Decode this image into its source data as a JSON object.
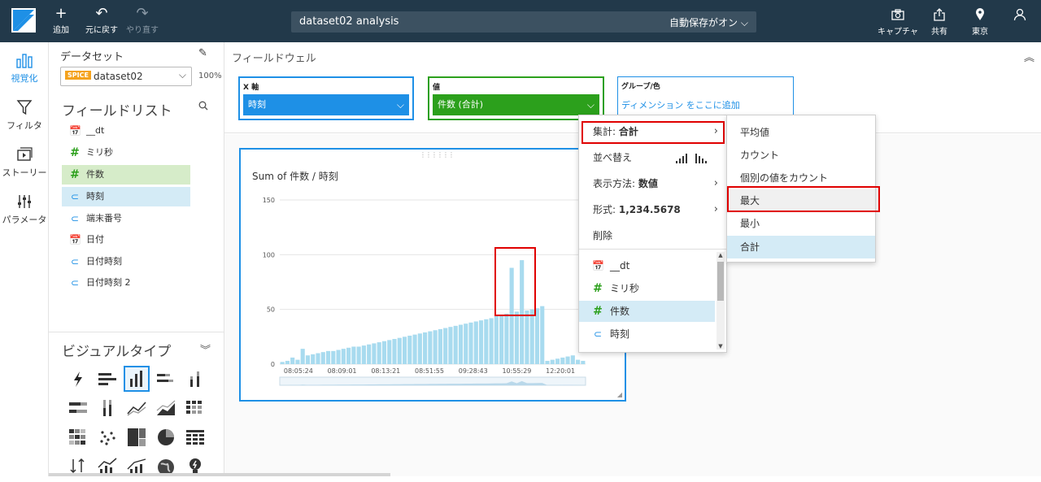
{
  "toolbar": {
    "add_label": "追加",
    "undo_label": "元に戻す",
    "redo_label": "やり直す",
    "analysis_name": "dataset02 analysis",
    "autosave_label": "自動保存がオン",
    "capture_label": "キャプチャ",
    "share_label": "共有",
    "region_label": "東京"
  },
  "nav": {
    "visualize": "視覚化",
    "filter": "フィルタ",
    "story": "ストーリー",
    "parameter": "パラメータ"
  },
  "fieldpanel": {
    "dataset_label": "データセット",
    "spice_badge": "SPICE",
    "dataset_name": "dataset02",
    "percent": "100%",
    "field_list_title": "フィールドリスト",
    "fields": [
      "__dt",
      "ミリ秒",
      "件数",
      "時刻",
      "端末番号",
      "日付",
      "日付時刻",
      "日付時刻 2"
    ],
    "visual_types_title": "ビジュアルタイプ"
  },
  "wells": {
    "title": "フィールドウェル",
    "x_axis_label": "X 軸",
    "x_axis_field": "時刻",
    "value_label": "値",
    "value_field": "件数 (合計)",
    "group_label": "グループ/色",
    "group_placeholder": "ディメンション をここに追加"
  },
  "visual": {
    "title": "Sum of 件数 / 時刻"
  },
  "chart_data": {
    "type": "bar",
    "title": "Sum of 件数 / 時刻",
    "xlabel": "",
    "ylabel": "",
    "ylim": [
      0,
      150
    ],
    "y_ticks": [
      "150",
      "100",
      "50",
      "0"
    ],
    "x_ticks": [
      "08:05:24",
      "08:09:01",
      "08:13:21",
      "08:51:55",
      "09:28:43",
      "10:55:29",
      "12:20:01"
    ],
    "values": [
      2,
      3,
      6,
      4,
      14,
      8,
      9,
      10,
      11,
      12,
      12,
      13,
      14,
      15,
      16,
      16,
      17,
      18,
      19,
      20,
      21,
      22,
      23,
      24,
      25,
      26,
      27,
      28,
      29,
      30,
      31,
      32,
      33,
      34,
      35,
      36,
      37,
      38,
      39,
      40,
      41,
      42,
      44,
      45,
      46,
      88,
      48,
      95,
      49,
      50,
      51,
      53,
      3,
      4,
      5,
      6,
      7,
      8,
      4,
      3
    ],
    "bar_color": "#a8dbef"
  },
  "menu": {
    "aggregate_prefix": "集計: ",
    "aggregate_value": "合計",
    "sort_label": "並べ替え",
    "display_prefix": "表示方法: ",
    "display_value": "数値",
    "format_prefix": "形式: ",
    "format_value": "1,234.5678",
    "delete_label": "削除",
    "fields": [
      "__dt",
      "ミリ秒",
      "件数",
      "時刻"
    ]
  },
  "submenu": {
    "items": [
      "平均値",
      "カウント",
      "個別の値をカウント",
      "最大",
      "最小",
      "合計"
    ]
  }
}
